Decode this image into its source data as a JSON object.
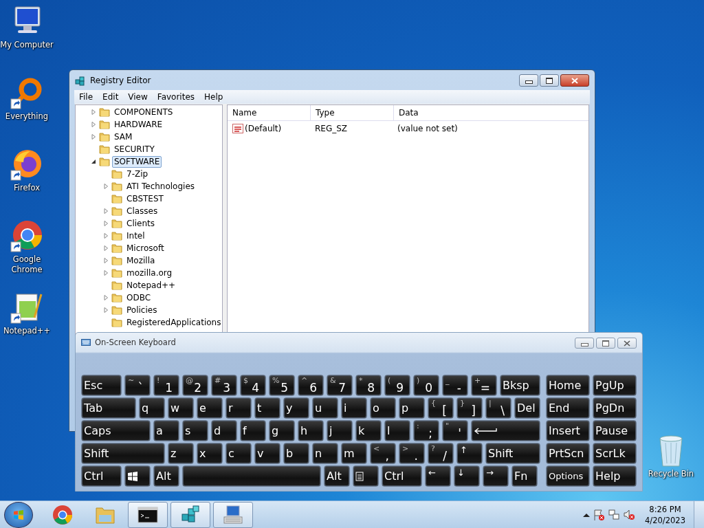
{
  "desktop_icons": [
    {
      "label": "My Computer",
      "kind": "computer",
      "shortcut": false
    },
    {
      "label": "Everything",
      "kind": "ring",
      "shortcut": true
    },
    {
      "label": "Firefox",
      "kind": "fox",
      "shortcut": true
    },
    {
      "label": "Google Chrome",
      "kind": "chrome",
      "shortcut": true
    },
    {
      "label": "Notepad++",
      "kind": "notepad",
      "shortcut": true
    }
  ],
  "recycle_bin": {
    "label": "Recycle Bin"
  },
  "registry": {
    "title": "Registry Editor",
    "menu": [
      "File",
      "Edit",
      "View",
      "Favorites",
      "Help"
    ],
    "tree": [
      {
        "label": "COMPONENTS",
        "expandable": true,
        "expanded": false,
        "selected": false
      },
      {
        "label": "HARDWARE",
        "expandable": true,
        "expanded": false,
        "selected": false
      },
      {
        "label": "SAM",
        "expandable": true,
        "expanded": false,
        "selected": false
      },
      {
        "label": "SECURITY",
        "expandable": false,
        "expanded": false,
        "selected": false
      },
      {
        "label": "SOFTWARE",
        "expandable": true,
        "expanded": true,
        "selected": true,
        "children": [
          {
            "label": "7-Zip",
            "expandable": false,
            "expanded": false,
            "selected": false
          },
          {
            "label": "ATI Technologies",
            "expandable": true,
            "expanded": false,
            "selected": false
          },
          {
            "label": "CBSTEST",
            "expandable": false,
            "expanded": false,
            "selected": false
          },
          {
            "label": "Classes",
            "expandable": true,
            "expanded": false,
            "selected": false
          },
          {
            "label": "Clients",
            "expandable": true,
            "expanded": false,
            "selected": false
          },
          {
            "label": "Intel",
            "expandable": true,
            "expanded": false,
            "selected": false
          },
          {
            "label": "Microsoft",
            "expandable": true,
            "expanded": false,
            "selected": false
          },
          {
            "label": "Mozilla",
            "expandable": true,
            "expanded": false,
            "selected": false
          },
          {
            "label": "mozilla.org",
            "expandable": true,
            "expanded": false,
            "selected": false
          },
          {
            "label": "Notepad++",
            "expandable": false,
            "expanded": false,
            "selected": false
          },
          {
            "label": "ODBC",
            "expandable": true,
            "expanded": false,
            "selected": false
          },
          {
            "label": "Policies",
            "expandable": true,
            "expanded": false,
            "selected": false
          },
          {
            "label": "RegisteredApplications",
            "expandable": false,
            "expanded": false,
            "selected": false
          }
        ]
      }
    ],
    "columns": [
      "Name",
      "Type",
      "Data"
    ],
    "rows": [
      {
        "name": "(Default)",
        "type": "REG_SZ",
        "data": "(value not set)"
      }
    ]
  },
  "keyboard": {
    "title": "On-Screen Keyboard",
    "main_rows": [
      [
        {
          "kind": "mod",
          "label": "Esc"
        },
        {
          "kind": "char",
          "top": "~",
          "label": "`"
        },
        {
          "kind": "char",
          "top": "!",
          "label": "1"
        },
        {
          "kind": "char",
          "top": "@",
          "label": "2"
        },
        {
          "kind": "char",
          "top": "#",
          "label": "3"
        },
        {
          "kind": "char",
          "top": "$",
          "label": "4"
        },
        {
          "kind": "char",
          "top": "%",
          "label": "5"
        },
        {
          "kind": "char",
          "top": "^",
          "label": "6"
        },
        {
          "kind": "char",
          "top": "&",
          "label": "7"
        },
        {
          "kind": "char",
          "top": "*",
          "label": "8"
        },
        {
          "kind": "char",
          "top": "(",
          "label": "9"
        },
        {
          "kind": "char",
          "top": ")",
          "label": "0"
        },
        {
          "kind": "char",
          "top": "_",
          "label": "-"
        },
        {
          "kind": "char",
          "top": "+",
          "label": "="
        },
        {
          "kind": "mod",
          "label": "Bksp"
        }
      ],
      [
        {
          "kind": "tab",
          "label": "Tab"
        },
        {
          "kind": "key",
          "label": "q"
        },
        {
          "kind": "key",
          "label": "w"
        },
        {
          "kind": "key",
          "label": "e"
        },
        {
          "kind": "key",
          "label": "r"
        },
        {
          "kind": "key",
          "label": "t"
        },
        {
          "kind": "key",
          "label": "y"
        },
        {
          "kind": "key",
          "label": "u"
        },
        {
          "kind": "key",
          "label": "i"
        },
        {
          "kind": "key",
          "label": "o"
        },
        {
          "kind": "key",
          "label": "p"
        },
        {
          "kind": "char",
          "top": "{",
          "label": "["
        },
        {
          "kind": "char",
          "top": "}",
          "label": "]"
        },
        {
          "kind": "char",
          "top": "|",
          "label": "\\"
        },
        {
          "kind": "key",
          "label": "Del"
        }
      ],
      [
        {
          "kind": "caps",
          "label": "Caps"
        },
        {
          "kind": "key",
          "label": "a"
        },
        {
          "kind": "key",
          "label": "s"
        },
        {
          "kind": "key",
          "label": "d"
        },
        {
          "kind": "key",
          "label": "f"
        },
        {
          "kind": "key",
          "label": "g"
        },
        {
          "kind": "key",
          "label": "h"
        },
        {
          "kind": "key",
          "label": "j"
        },
        {
          "kind": "key",
          "label": "k"
        },
        {
          "kind": "key",
          "label": "l"
        },
        {
          "kind": "char",
          "top": ":",
          "label": ";"
        },
        {
          "kind": "char",
          "top": "\"",
          "label": "'"
        },
        {
          "kind": "enter"
        }
      ],
      [
        {
          "kind": "shift",
          "label": "Shift"
        },
        {
          "kind": "key",
          "label": "z"
        },
        {
          "kind": "key",
          "label": "x"
        },
        {
          "kind": "key",
          "label": "c"
        },
        {
          "kind": "key",
          "label": "v"
        },
        {
          "kind": "key",
          "label": "b"
        },
        {
          "kind": "key",
          "label": "n"
        },
        {
          "kind": "key",
          "label": "m"
        },
        {
          "kind": "char",
          "top": "<",
          "label": ","
        },
        {
          "kind": "char",
          "top": ">",
          "label": "."
        },
        {
          "kind": "char",
          "top": "?",
          "label": "/"
        },
        {
          "kind": "arrow",
          "label": "↑"
        },
        {
          "kind": "rshift",
          "label": "Shift"
        }
      ],
      [
        {
          "kind": "mod",
          "label": "Ctrl"
        },
        {
          "kind": "win"
        },
        {
          "kind": "key",
          "label": "Alt"
        },
        {
          "kind": "space"
        },
        {
          "kind": "key",
          "label": "Alt"
        },
        {
          "kind": "menu"
        },
        {
          "kind": "mod",
          "label": "Ctrl"
        },
        {
          "kind": "arrow",
          "label": "←"
        },
        {
          "kind": "arrow",
          "label": "↓"
        },
        {
          "kind": "arrow",
          "label": "→"
        },
        {
          "kind": "key",
          "label": "Fn"
        }
      ]
    ],
    "side_rows": [
      [
        "Home",
        "PgUp"
      ],
      [
        "End",
        "PgDn"
      ],
      [
        "Insert",
        "Pause"
      ],
      [
        "PrtScn",
        "ScrLk"
      ],
      [
        "Options",
        "Help"
      ]
    ]
  },
  "taskbar": {
    "apps": [
      {
        "kind": "chrome",
        "running": false
      },
      {
        "kind": "folder",
        "running": false
      },
      {
        "kind": "console",
        "running": true
      },
      {
        "kind": "registry",
        "running": true
      },
      {
        "kind": "keyboard",
        "running": true
      }
    ],
    "time": "8:26 PM",
    "date": "4/20/2023"
  }
}
